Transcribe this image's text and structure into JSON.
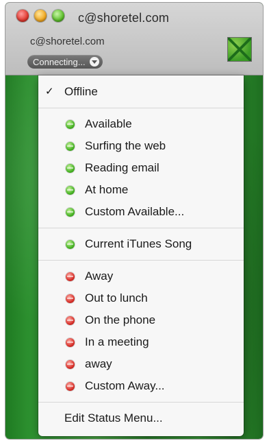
{
  "window": {
    "title": "c@shoretel.com",
    "account_name": "c@shoretel.com",
    "status_label": "Connecting..."
  },
  "menu": {
    "offline": "Offline",
    "available": [
      "Available",
      "Surfing the web",
      "Reading email",
      "At home",
      "Custom Available..."
    ],
    "itunes": "Current iTunes Song",
    "away": [
      "Away",
      "Out to lunch",
      "On the phone",
      "In a meeting",
      "away",
      "Custom Away..."
    ],
    "edit": "Edit Status Menu...",
    "check_mark": "✓"
  },
  "colors": {
    "available": "#47b324",
    "away": "#d8302a",
    "background": "#3aa63c"
  }
}
